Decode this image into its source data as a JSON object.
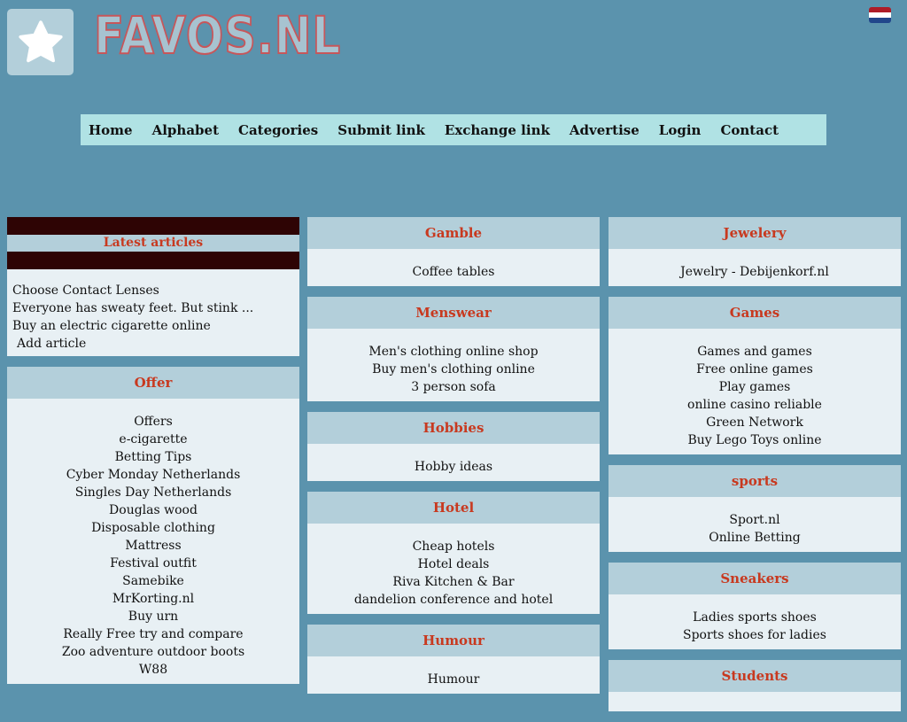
{
  "site": {
    "logo_text": "FAVOS.NL",
    "flag_colors": [
      "#ae1c28",
      "#ffffff",
      "#21468b"
    ]
  },
  "nav": [
    "Home",
    "Alphabet",
    "Categories",
    "Submit link",
    "Exchange link",
    "Advertise",
    "Login",
    "Contact"
  ],
  "latest": {
    "title": "Latest articles",
    "items": [
      "Choose Contact Lenses",
      "Everyone has sweaty feet. But stink ...",
      "Buy an electric cigarette online"
    ],
    "add_label": "Add article"
  },
  "columns": [
    [
      {
        "title": "Offer",
        "links": [
          "Offers",
          "e-cigarette",
          "Betting Tips",
          "Cyber Monday Netherlands",
          "Singles Day Netherlands",
          "Douglas wood",
          "Disposable clothing",
          "Mattress",
          "Festival outfit",
          "Samebike",
          "MrKorting.nl",
          "Buy urn",
          "Really Free try and compare",
          "Zoo adventure outdoor boots",
          "W88"
        ]
      }
    ],
    [
      {
        "title": "Gamble",
        "links": [
          "Coffee tables"
        ]
      },
      {
        "title": "Menswear",
        "links": [
          "Men's clothing online shop",
          "Buy men's clothing online",
          "3 person sofa"
        ]
      },
      {
        "title": "Hobbies",
        "links": [
          "Hobby ideas"
        ]
      },
      {
        "title": "Hotel",
        "links": [
          "Cheap hotels",
          "Hotel deals",
          "Riva Kitchen & Bar",
          "dandelion conference and hotel"
        ]
      },
      {
        "title": "Humour",
        "links": [
          "Humour"
        ]
      }
    ],
    [
      {
        "title": "Jewelery",
        "links": [
          "Jewelry - Debijenkorf.nl"
        ]
      },
      {
        "title": "Games",
        "links": [
          "Games and games",
          "Free online games",
          "Play games",
          "online casino reliable",
          "Green Network",
          "Buy Lego Toys online"
        ]
      },
      {
        "title": "sports",
        "links": [
          "Sport.nl",
          "Online Betting"
        ]
      },
      {
        "title": "Sneakers",
        "links": [
          "Ladies sports shoes",
          "Sports shoes for ladies"
        ]
      },
      {
        "title": "Students",
        "links": []
      }
    ]
  ]
}
